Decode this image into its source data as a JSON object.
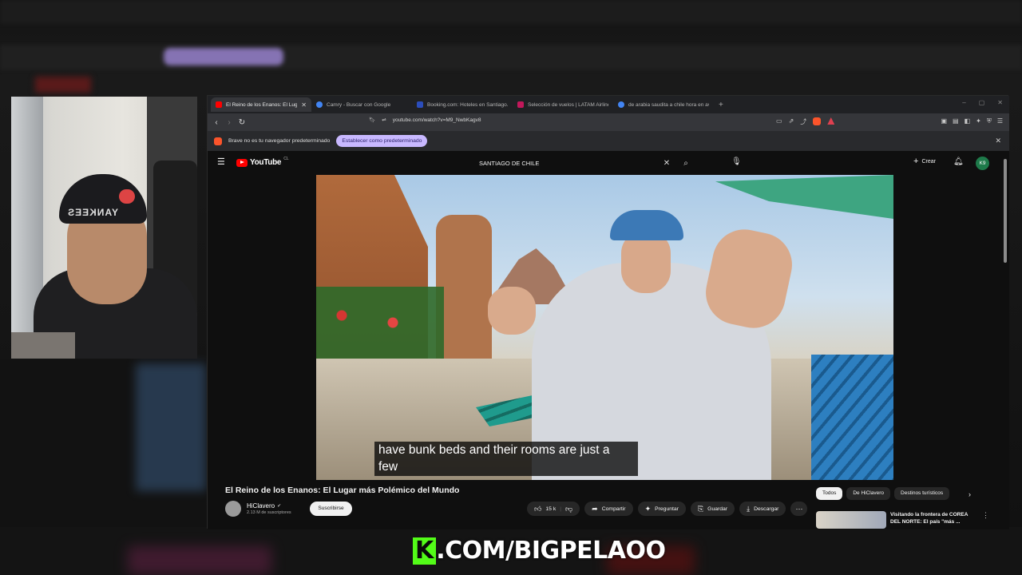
{
  "browser": {
    "tabs": [
      {
        "label": "El Reino de los Enanos: El Lug",
        "active": true,
        "favicon_color": "#ff0000"
      },
      {
        "label": "Camry - Buscar con Google",
        "active": false,
        "favicon_color": "#4285f4"
      },
      {
        "label": "Booking.com: Hoteles en Santiago.",
        "active": false,
        "favicon_color": "#2b4dbb"
      },
      {
        "label": "Selección de vuelos | LATAM Airlines",
        "active": false,
        "favicon_color": "#c2185b"
      },
      {
        "label": "de arabia saudita a chile hora en avi",
        "active": false,
        "favicon_color": "#4285f4"
      }
    ],
    "new_tab": "+",
    "tab_close": "✕",
    "url": "youtube.com/watch?v=M9_NwbKagv8",
    "infobar_text": "Brave no es tu navegador predeterminado",
    "infobar_button": "Establecer como predeterminado",
    "infobar_close": "✕"
  },
  "youtube": {
    "logo_text": "YouTube",
    "region": "CL",
    "search_query": "SANTIAGO DE CHILE",
    "create_label": "Crear",
    "avatar_initials": "K9",
    "caption_line1": "have bunk beds and their rooms are just a",
    "caption_line2": "few",
    "video_title": "El Reino de los Enanos: El Lugar más Polémico del Mundo",
    "channel_name": "HiClavero",
    "channel_subs": "2.13 M de suscriptores",
    "subscribe_label": "Suscribirse",
    "likes": "15 k",
    "share_label": "Compartir",
    "ask_label": "Preguntar",
    "save_label": "Guardar",
    "download_label": "Descargar",
    "chips": [
      "Todos",
      "De HiClavero",
      "Destinos turísticos"
    ],
    "rec_title": "Visitando la frontera de COREA DEL NORTE: El país \"más ..."
  },
  "overlay": {
    "brand_k": "K",
    "brand_rest": ".COM/BIGPELAOO"
  },
  "webcam": {
    "cap_text": "YANKEES"
  },
  "colors": {
    "accent": "#53fc18",
    "youtube_red": "#ff0000",
    "infobar_button": "#c8b8ff"
  }
}
